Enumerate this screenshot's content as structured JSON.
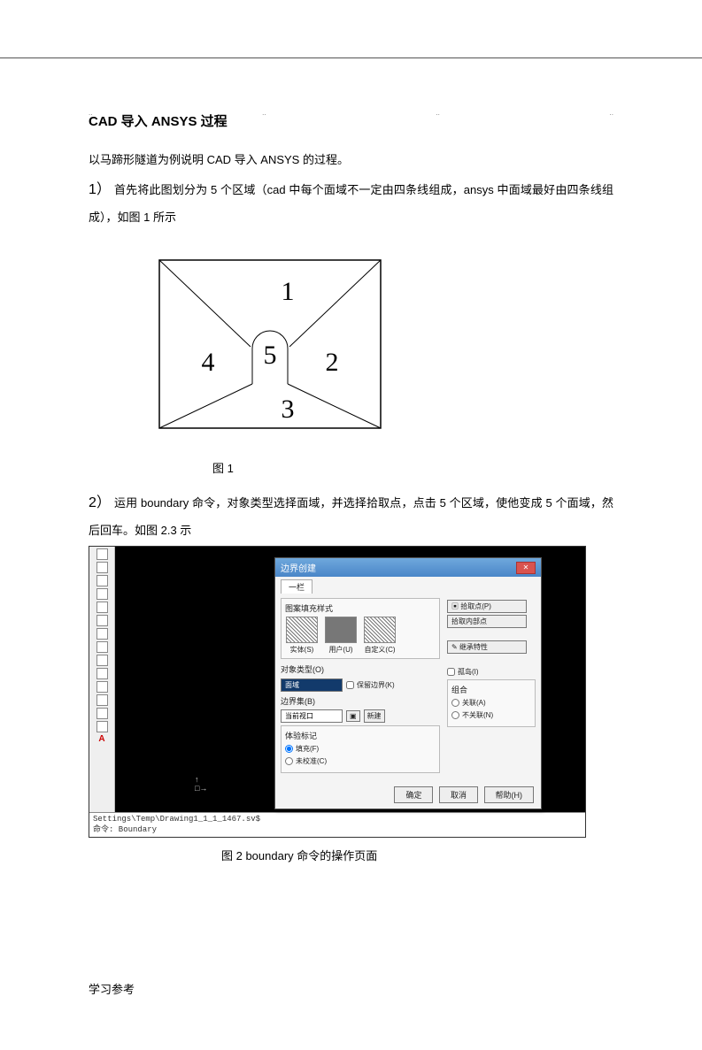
{
  "header_dots": [
    "..",
    "..",
    "..",
    ".."
  ],
  "title": "CAD 导入 ANSYS 过程",
  "intro": "以马蹄形隧道为例说明 CAD 导入 ANSYS 的过程。",
  "step1_num": "1）",
  "step1_text": "首先将此图划分为 5 个区域（cad 中每个面域不一定由四条线组成，ansys 中面域最好由四条线组成），如图 1 所示",
  "fig1": {
    "labels": {
      "l1": "1",
      "l2": "2",
      "l3": "3",
      "l4": "4",
      "l5": "5"
    },
    "caption": "图 1"
  },
  "step2_num": "2）",
  "step2_text": "运用 boundary 命令，对象类型选择面域，并选择拾取点，点击 5 个区域，使他变成 5 个面域，然后回车。如图 2.3 示",
  "dlg": {
    "title": "边界创建",
    "tab": "一栏",
    "group_hatch": "图案填充样式",
    "hatch_labels": [
      "实体(S)",
      "用户(U)",
      "自定义(C)"
    ],
    "obj_label": "对象类型(O)",
    "obj_value": "面域",
    "keep_bound": "保留边界(K)",
    "bset_label": "边界集(B)",
    "bset_value": "当前视口",
    "bset_new": "新建",
    "opt_title": "体验标记",
    "opt_region": "填充(F)",
    "opt_poly": "未校准(C)",
    "pick_btn1": "拾取点(P)",
    "pick_btn2": "拾取内部点",
    "recover": "继承特性",
    "double": "孤岛(I)",
    "grp_title": "组合",
    "grp_a": "关联(A)",
    "grp_b": "不关联(N)",
    "ok": "确定",
    "cancel": "取消",
    "help": "帮助(H)"
  },
  "ucs_y": "↑",
  "ucs_o": "□→",
  "cmd1": "Settings\\Temp\\Drawing1_1_1_1467.sv$",
  "cmd2": "命令: Boundary",
  "fig2_caption": "图 2 boundary 命令的操作页面",
  "footer": "学习参考"
}
